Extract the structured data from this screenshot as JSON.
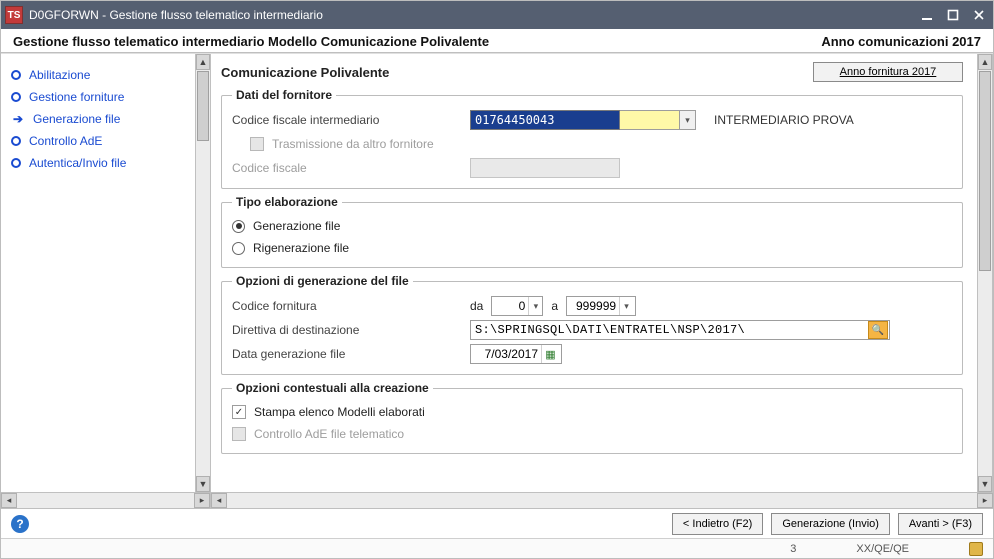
{
  "window": {
    "app_icon_letter": "TS",
    "title": "D0GFORWN - Gestione flusso telematico intermediario"
  },
  "subheader": {
    "left": "Gestione flusso telematico intermediario Modello Comunicazione Polivalente",
    "right": "Anno comunicazioni 2017"
  },
  "nav": {
    "items": [
      {
        "label": "Abilitazione",
        "active": false
      },
      {
        "label": "Gestione forniture",
        "active": false
      },
      {
        "label": "Generazione file",
        "active": true
      },
      {
        "label": "Controllo AdE",
        "active": false
      },
      {
        "label": "Autentica/Invio file",
        "active": false
      }
    ]
  },
  "panel": {
    "title": "Comunicazione Polivalente",
    "year_button": "Anno fornitura 2017"
  },
  "supplier": {
    "legend": "Dati del fornitore",
    "cf_label": "Codice fiscale intermediario",
    "cf_value": "01764450043",
    "associate_name": "INTERMEDIARIO PROVA",
    "other_supplier_label": "Trasmissione da altro fornitore",
    "other_cf_label": "Codice fiscale"
  },
  "elab": {
    "legend": "Tipo elaborazione",
    "opt1": "Generazione file",
    "opt2": "Rigenerazione file"
  },
  "gen": {
    "legend": "Opzioni di generazione del file",
    "code_label": "Codice fornitura",
    "from_label": "da",
    "from_value": "0",
    "to_label": "a",
    "to_value": "999999",
    "dir_label": "Direttiva di destinazione",
    "dir_value": "S:\\SPRINGSQL\\DATI\\ENTRATEL\\NSP\\2017\\",
    "date_label": "Data generazione file",
    "date_value": "7/03/2017"
  },
  "ctx": {
    "legend": "Opzioni contestuali alla creazione",
    "chk1": "Stampa elenco Modelli elaborati",
    "chk2": "Controllo AdE file telematico"
  },
  "footer": {
    "back": "< Indietro (F2)",
    "gen": "Generazione (Invio)",
    "fwd": "Avanti > (F3)"
  },
  "status": {
    "num": "3",
    "code": "XX/QE/QE"
  }
}
